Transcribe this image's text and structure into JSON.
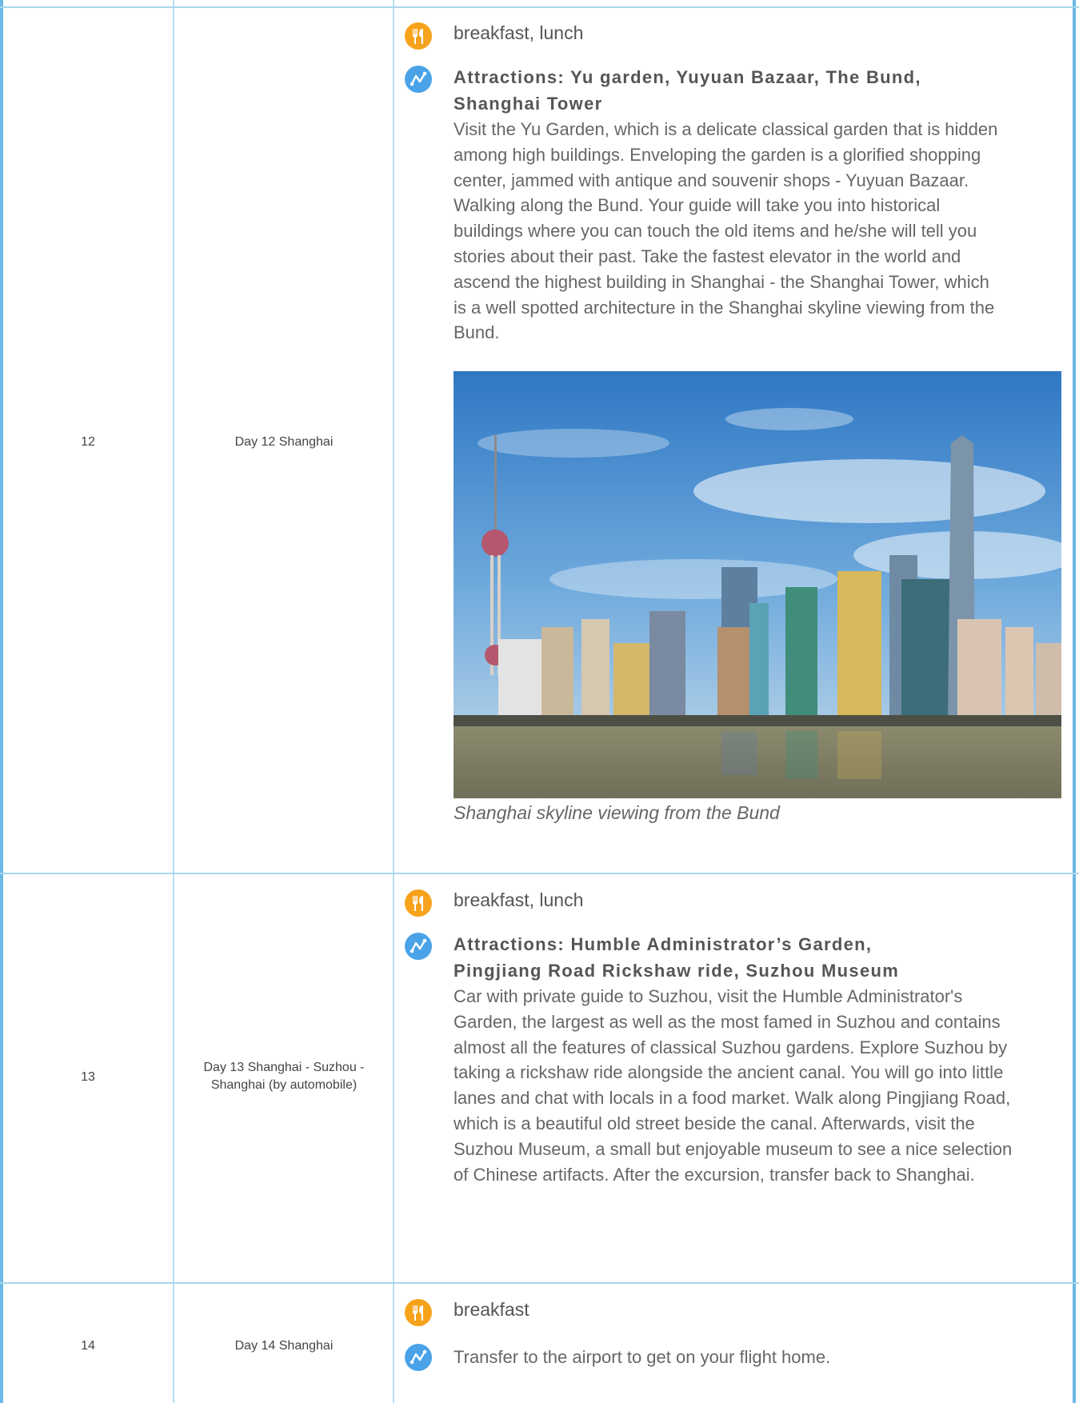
{
  "rows": [
    {
      "num": "12",
      "day": "Day 12 Shanghai",
      "meals": "breakfast, lunch",
      "title": "Attractions: Yu garden, Yuyuan Bazaar, The Bund, Shanghai Tower",
      "desc": "Visit the Yu Garden, which is a delicate classical garden that is hidden among high buildings. Enveloping the garden is a glorified shopping center, jammed with antique and souvenir shops - Yuyuan Bazaar. Walking along the Bund. Your guide will take you into historical buildings where you can touch the old items and he/she will tell you stories about their past. Take the fastest elevator in the world and ascend the highest building in Shanghai - the Shanghai Tower, which is a well spotted architecture in the Shanghai skyline viewing from the Bund.",
      "caption": "Shanghai skyline viewing from the Bund"
    },
    {
      "num": "13",
      "day": "Day 13 Shanghai - Suzhou - Shanghai (by automobile)",
      "meals": "breakfast, lunch",
      "title": "Attractions: Humble Administrator’s Garden, Pingjiang Road Rickshaw ride, Suzhou Museum",
      "desc": "Car with private guide to Suzhou, visit the Humble Administrator's Garden, the largest as well as the most famed in Suzhou and contains almost all the features of classical Suzhou gardens. Explore Suzhou by taking a rickshaw ride alongside the ancient canal. You will go into little lanes and chat with locals in a food market. Walk along Pingjiang Road, which is a beautiful old street beside the canal. Afterwards, visit the Suzhou Museum, a small but enjoyable museum to see a nice selection of Chinese artifacts. After the excursion, transfer back to Shanghai."
    },
    {
      "num": "14",
      "day": "Day 14 Shanghai",
      "meals": "breakfast",
      "desc": "Transfer to the airport to get on your flight home."
    }
  ],
  "colors": {
    "meal_icon": "#f7a21b",
    "activity_icon": "#4aa3e8",
    "border": "#a9d6f0"
  },
  "icons": {
    "meal": "fork-knife-icon",
    "activity": "route-icon"
  }
}
